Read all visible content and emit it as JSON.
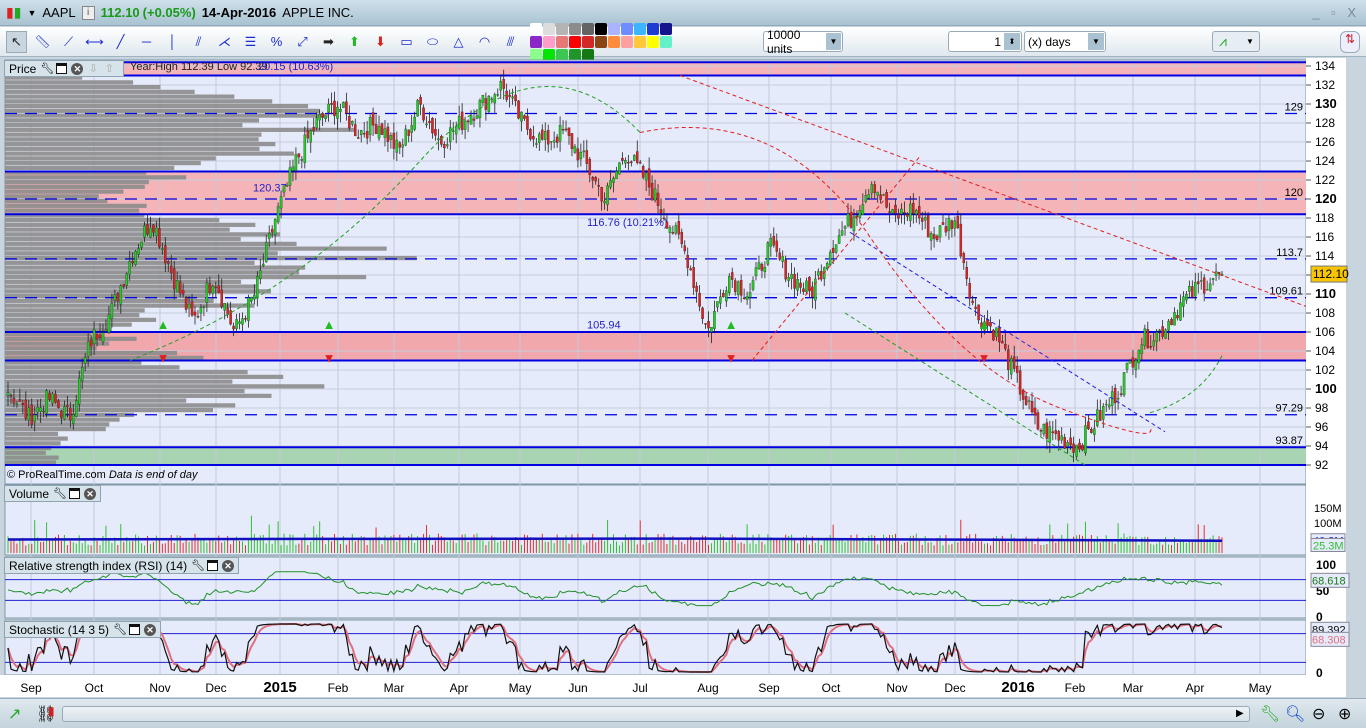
{
  "header": {
    "symbol": "AAPL",
    "price": "112.10",
    "change": "(+0.05%)",
    "date": "14-Apr-2016",
    "name": "APPLE INC.",
    "window_controls": "_ ▫ X"
  },
  "toolbar": {
    "units": "10000 units",
    "period_value": "1",
    "period_unit": "(x) days",
    "tools": [
      "cursor-icon",
      "ruler-icon",
      "point-line-icon",
      "horizontal-segment-icon",
      "trendline-icon",
      "horizontal-line-icon",
      "vertical-line-icon",
      "channel-icon",
      "fan-icon",
      "fibonacci-icon",
      "percent-icon",
      "point-icon",
      "arrow-right-icon",
      "arrow-up-icon",
      "arrow-down-icon",
      "rectangle-icon",
      "ellipse-icon",
      "triangle-icon",
      "arc-icon",
      "parallel-lines-icon"
    ],
    "colors": [
      "#ffffff",
      "#dcdcdc",
      "#b4b4b4",
      "#8c8c8c",
      "#646464",
      "#000000",
      "#aab4ff",
      "#6e8cff",
      "#3cb4ff",
      "#1e3cd2",
      "#14148c",
      "#8c28c8",
      "#ff9ec8",
      "#e67878",
      "#ff0000",
      "#d22828",
      "#8c4614",
      "#ff8c3c",
      "#ffa0a0",
      "#ffc83c",
      "#ffff00",
      "#64f0c8",
      "#8cff8c",
      "#00e600",
      "#3cc850",
      "#1e9628",
      "#147814"
    ]
  },
  "price_panel": {
    "label": "Price",
    "year_info": "Year:High 112.39 Low 92.39",
    "overlap_text": "20.15 (10.63%)",
    "price_tag": "112.10",
    "copyright": "© ProRealTime.com",
    "data_note": "Data is end of day",
    "annotations": [
      "120.37",
      "116.76 (10.21%)",
      "105.94"
    ],
    "level_labels": [
      "129",
      "120",
      "113.7",
      "109.61",
      "97.29",
      "93.87"
    ]
  },
  "volume_panel": {
    "label": "Volume",
    "ticks": [
      "150M",
      "100M"
    ],
    "tag_avg": "40.9M",
    "tag_vol": "25.3M"
  },
  "rsi_panel": {
    "label": "Relative strength index (RSI) (14)",
    "ticks": [
      "100",
      "50",
      "0"
    ],
    "tag": "68.618"
  },
  "stoch_panel": {
    "label": "Stochastic (14 3 5)",
    "ticks": [
      "0"
    ],
    "tag_k": "89.392",
    "tag_d": "68.308"
  },
  "chart_data": {
    "type": "candlestick",
    "title": "AAPL",
    "ylim": [
      91,
      134.5
    ],
    "y_ticks": [
      92,
      94,
      96,
      98,
      100,
      102,
      104,
      106,
      108,
      110,
      112,
      114,
      116,
      118,
      120,
      122,
      124,
      126,
      128,
      130,
      132,
      134
    ],
    "x_labels": [
      "Sep",
      "Oct",
      "Nov",
      "Dec",
      "2015",
      "Feb",
      "Mar",
      "Apr",
      "May",
      "Jun",
      "Jul",
      "Aug",
      "Sep",
      "Oct",
      "Nov",
      "Dec",
      "2016",
      "Feb",
      "Mar",
      "Apr",
      "May"
    ],
    "close_keyframes": [
      100,
      97,
      99,
      97,
      105,
      108,
      114,
      118,
      112,
      107,
      112,
      106,
      110,
      118,
      124,
      128,
      130,
      127,
      128,
      125,
      130,
      126,
      128,
      130,
      132,
      128,
      126,
      127,
      124,
      120,
      125,
      122,
      118,
      114,
      106,
      112,
      110,
      115,
      112,
      110,
      115,
      118,
      122,
      118,
      119,
      116,
      118,
      108,
      106,
      101,
      96,
      95,
      94,
      97,
      100,
      105,
      106,
      109,
      111,
      112.1
    ],
    "levels": [
      {
        "value": 129,
        "style": "dashed"
      },
      {
        "value": 120,
        "style": "dashed"
      },
      {
        "value": 113.7,
        "style": "dashed"
      },
      {
        "value": 109.61,
        "style": "dashed"
      },
      {
        "value": 97.29,
        "style": "dashed"
      },
      {
        "value": 93.87,
        "style": "solid"
      }
    ],
    "zones": [
      {
        "from": 133,
        "to": 134.4,
        "color": "#f4b4b8"
      },
      {
        "from": 118.4,
        "to": 122.9,
        "color": "#f4b4b8"
      },
      {
        "from": 103,
        "to": 106,
        "color": "#f0a8ac"
      },
      {
        "from": 92,
        "to": 93.87,
        "color": "#a9d4b4"
      }
    ]
  }
}
